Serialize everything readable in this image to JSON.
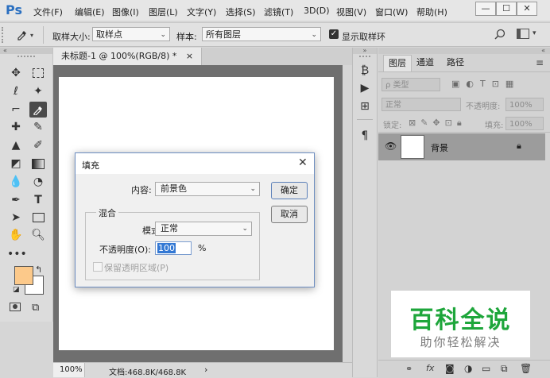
{
  "app": {
    "logo": "Ps"
  },
  "menu": [
    "文件(F)",
    "编辑(E)",
    "图像(I)",
    "图层(L)",
    "文字(Y)",
    "选择(S)",
    "滤镜(T)",
    "3D(D)",
    "视图(V)",
    "窗口(W)",
    "帮助(H)"
  ],
  "window_controls": {
    "minimize": "—",
    "restore": "☐",
    "close": "✕"
  },
  "options_bar": {
    "sample_size_label": "取样大小:",
    "sample_size_value": "取样点",
    "sample_label": "样本:",
    "sample_value": "所有图层",
    "show_ring_label": "显示取样环",
    "show_ring_checked": true
  },
  "document": {
    "tab_title": "未标题-1 @ 100%(RGB/8) *",
    "tab_close": "×",
    "zoom": "100%",
    "doc_info": "文档:468.8K/468.8K",
    "status_arrow": "›"
  },
  "layers_panel": {
    "tabs": [
      "图层",
      "通道",
      "路径"
    ],
    "active_tab": "图层",
    "filter_label": "ρ 类型",
    "blend_mode": "正常",
    "opacity_label": "不透明度:",
    "opacity_value": "100%",
    "lock_label": "锁定:",
    "fill_label": "填充:",
    "fill_value": "100%",
    "layer_name": "背景",
    "footer_icons": [
      "link-icon",
      "fx-icon",
      "mask-icon",
      "adjustment-icon",
      "folder-icon",
      "new-layer-icon",
      "trash-icon"
    ],
    "fx_text": "fx"
  },
  "colors": {
    "foreground": "#fcc98a",
    "background": "#ffffff",
    "accent": "#2a6fc0"
  },
  "dialog": {
    "title": "填充",
    "content_label": "内容:",
    "content_value": "前景色",
    "ok_label": "确定",
    "cancel_label": "取消",
    "blend_group_label": "混合",
    "mode_label": "模式:",
    "mode_value": "正常",
    "opacity_label": "不透明度(O):",
    "opacity_value": "100",
    "opacity_unit": "%",
    "preserve_label": "保留透明区域(P)"
  },
  "watermark": {
    "title": "百科全说",
    "subtitle": "助你轻松解决"
  }
}
